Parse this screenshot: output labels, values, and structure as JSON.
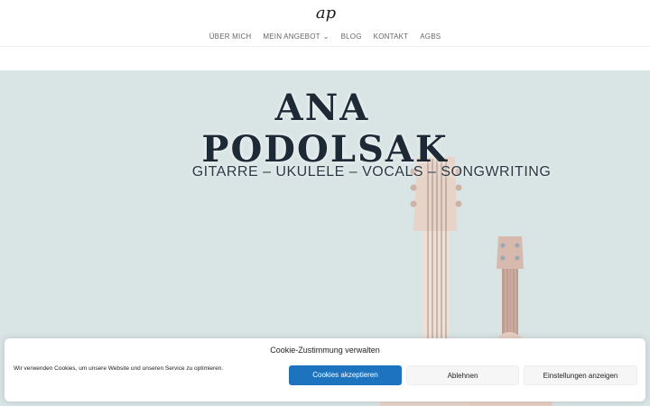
{
  "header": {
    "logo_text": "ap",
    "nav": [
      {
        "label": "ÜBER MICH"
      },
      {
        "label": "MEIN ANGEBOT"
      },
      {
        "label": "BLOG"
      },
      {
        "label": "KONTAKT"
      },
      {
        "label": "AGBS"
      }
    ]
  },
  "hero": {
    "title_line1": "ANA",
    "title_line2": "PODOLSAK",
    "subtitle": "GITARRE – UKULELE – VOCALS – SONGWRITING",
    "background_color": "#d9e4e5"
  },
  "cookie_banner": {
    "title": "Cookie-Zustimmung verwalten",
    "text": "Wir verwenden Cookies, um unsere Website und unseren Service zu optimieren.",
    "accept_label": "Cookies akzeptieren",
    "deny_label": "Ablehnen",
    "preferences_label": "Einstellungen anzeigen",
    "accent_color": "#1e73be"
  }
}
